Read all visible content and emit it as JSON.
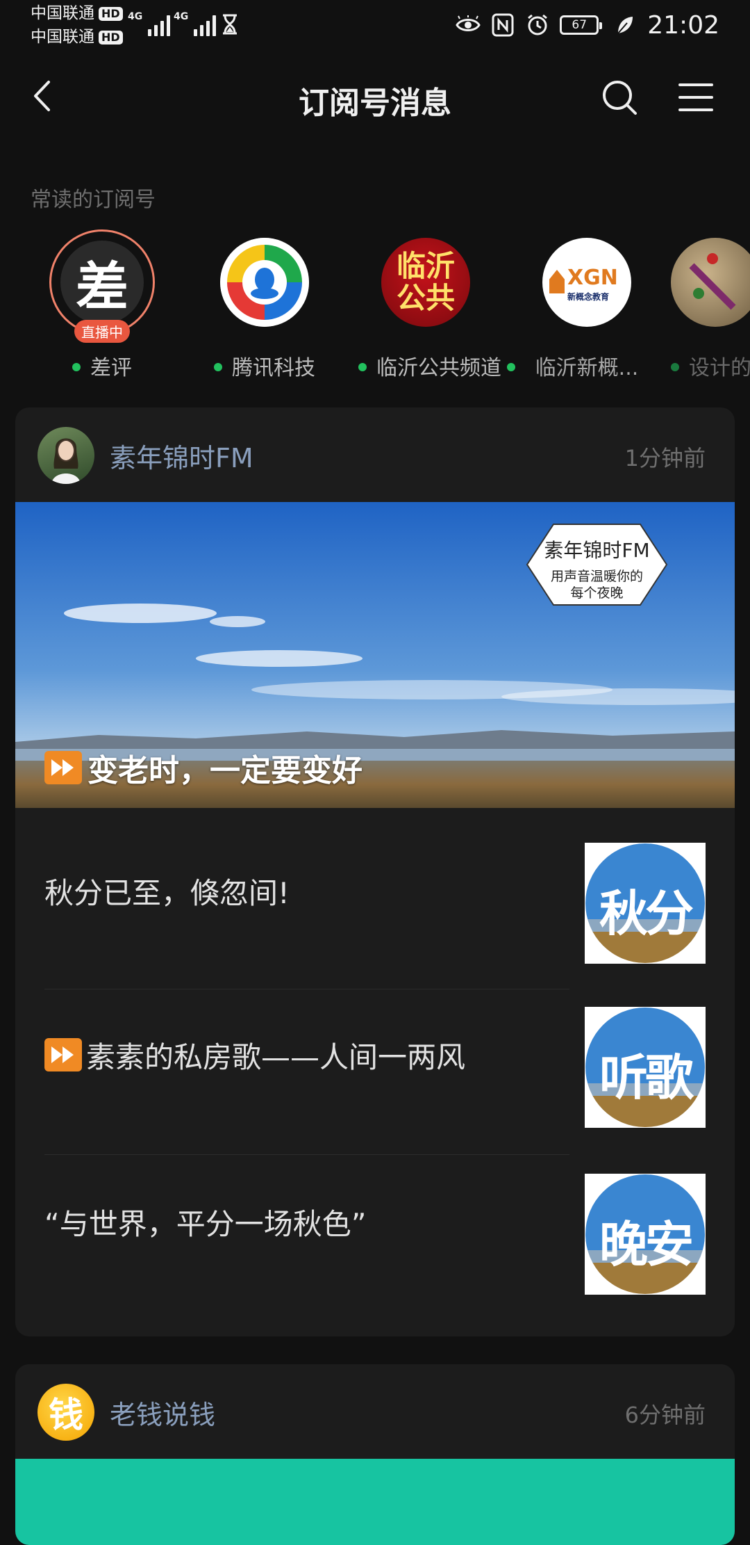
{
  "status_bar": {
    "carrier1": "中国联通",
    "carrier2": "中国联通",
    "hd": "HD",
    "net1": "4G",
    "net2": "4G",
    "battery": "67",
    "time": "21:02"
  },
  "nav": {
    "title": "订阅号消息"
  },
  "frequent": {
    "label": "常读的订阅号",
    "live_label": "直播中",
    "items": [
      {
        "name": "差评",
        "avatar_text": "差"
      },
      {
        "name": "腾讯科技"
      },
      {
        "name": "临沂公共频道",
        "avatar_text_1": "临沂",
        "avatar_text_2": "公共"
      },
      {
        "name": "临沂新概...",
        "avatar_text": "XGN",
        "avatar_sub": "新概念教育"
      },
      {
        "name": "设计的"
      }
    ]
  },
  "card1": {
    "account": "素年锦时FM",
    "time": "1分钟前",
    "hero_title": "变老时，一定要变好",
    "logo_line1": "素年锦时FM",
    "logo_line2": "用声音温暖你的",
    "logo_line3": "每个夜晚",
    "articles": [
      {
        "title": "秋分已至，倏忽间!",
        "thumb_text": "秋分"
      },
      {
        "title": "素素的私房歌——人间一两风",
        "thumb_text": "听歌"
      },
      {
        "title": "“与世界，平分一场秋色”",
        "thumb_text": "晚安"
      }
    ]
  },
  "card2": {
    "account": "老钱说钱",
    "avatar_text": "钱",
    "time": "6分钟前"
  },
  "colors": {
    "background": "#111111",
    "card": "#1c1c1c",
    "account_name": "#8a9fbd",
    "online_dot": "#22c15e",
    "live_badge": "#e9573f",
    "teal": "#17c4a1"
  }
}
